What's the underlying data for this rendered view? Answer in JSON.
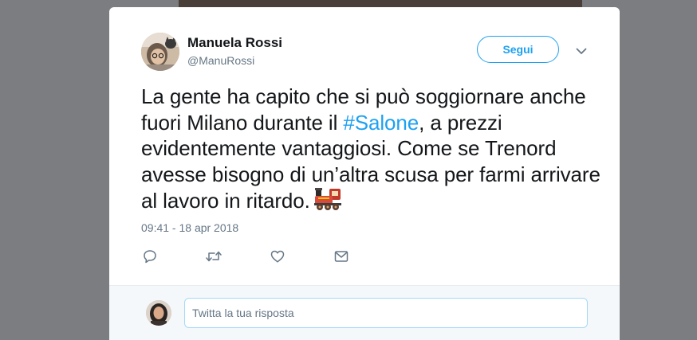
{
  "tweet": {
    "author_name": "Manuela Rossi",
    "author_handle": "@ManuRossi",
    "follow_label": "Segui",
    "text_before_hashtag": "La gente ha capito che si può soggiornare anche fuori Milano durante il ",
    "hashtag": "#Salone",
    "text_after_hashtag": ", a prezzi evidentemente vantaggiosi. Come se Trenord avesse bisogno di un’altra scusa per farmi arrivare al lavoro in ritardo.",
    "emoji": "steam-locomotive-emoji",
    "timestamp": "09:41 - 18 apr 2018",
    "actions": [
      "reply-icon",
      "retweet-icon",
      "like-icon",
      "direct-message-icon"
    ]
  },
  "reply": {
    "placeholder": "Twitta la tua risposta"
  },
  "colors": {
    "accent": "#1da1f2",
    "text": "#14171a",
    "muted": "#657786",
    "backdrop": "#7b7d80"
  }
}
